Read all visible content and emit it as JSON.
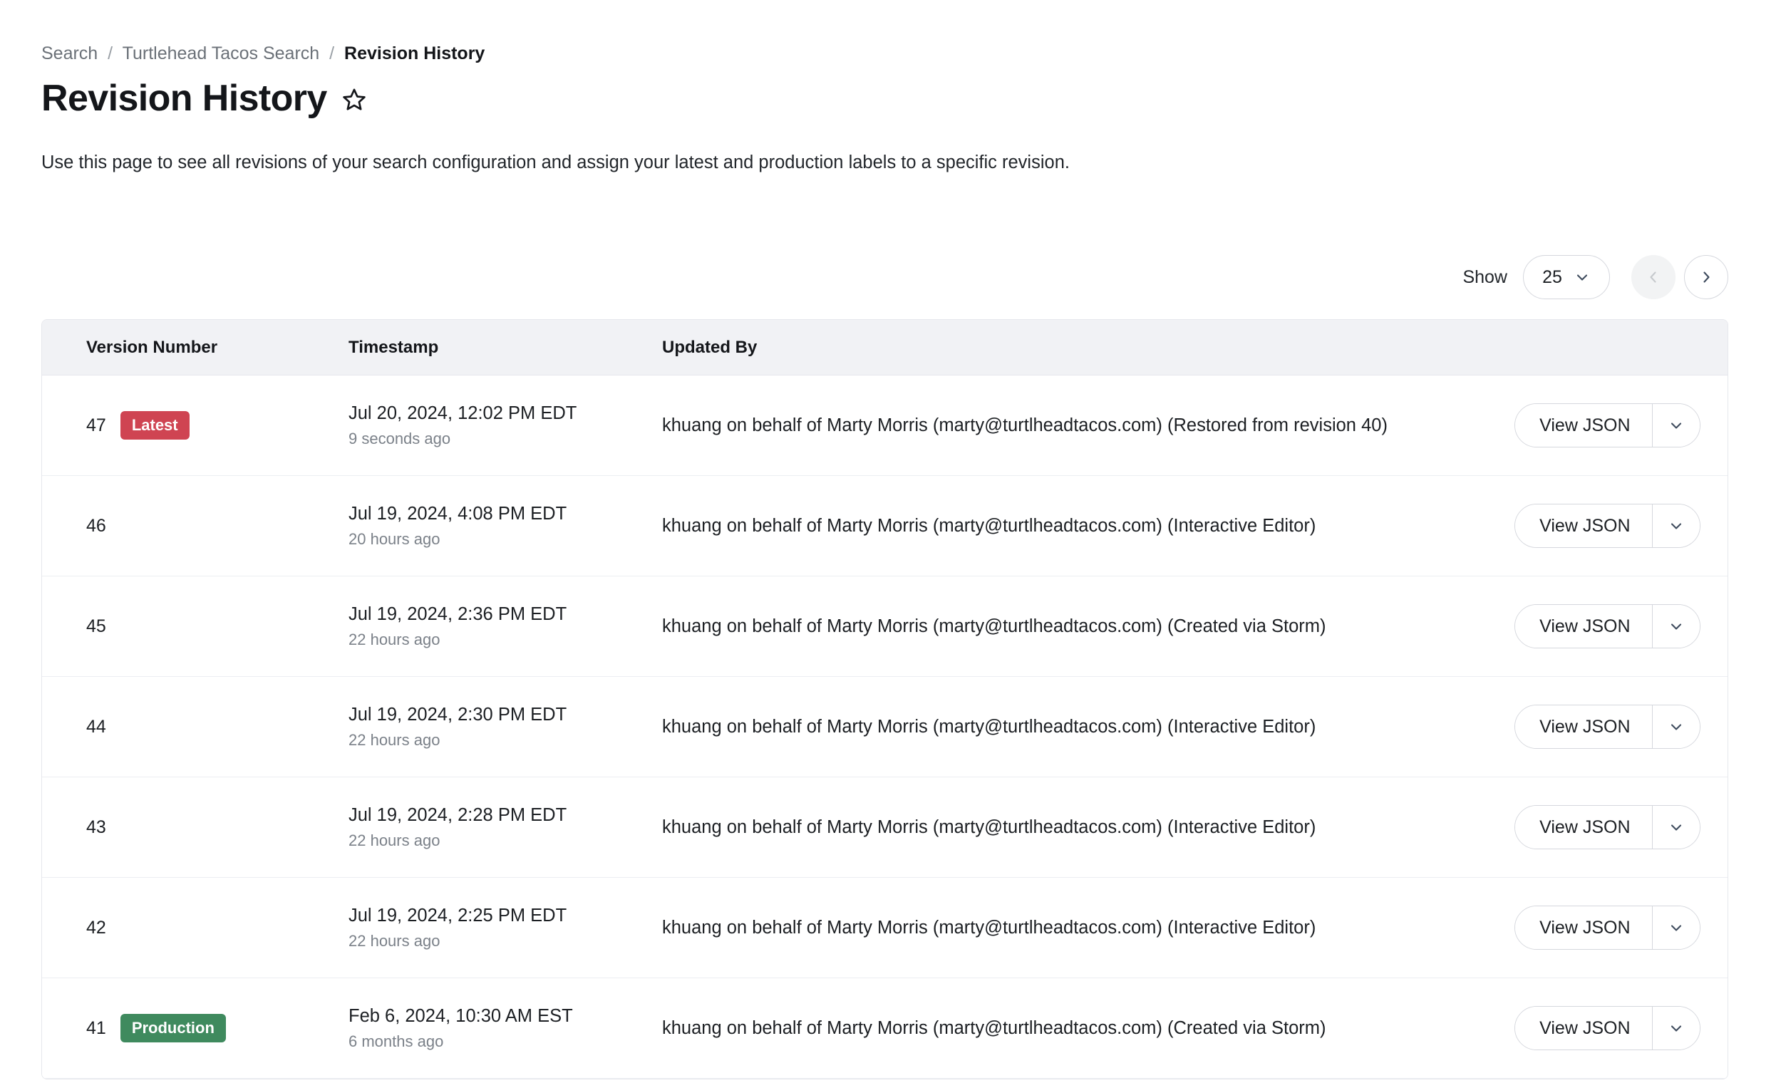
{
  "breadcrumb": {
    "items": [
      {
        "label": "Search",
        "current": false
      },
      {
        "label": "Turtlehead Tacos Search",
        "current": false
      },
      {
        "label": "Revision History",
        "current": true
      }
    ],
    "separator": "/"
  },
  "header": {
    "title": "Revision History",
    "favorite_icon": "star-outline-icon",
    "description": "Use this page to see all revisions of your search configuration and assign your latest and production labels to a specific revision."
  },
  "toolbar": {
    "show_label": "Show",
    "page_size_value": "25",
    "page_size_options": [
      "25"
    ],
    "prev_label": "Previous page",
    "next_label": "Next page",
    "prev_enabled": false,
    "next_enabled": true
  },
  "table": {
    "columns": [
      "Version Number",
      "Timestamp",
      "Updated By"
    ],
    "action_label": "View JSON",
    "rows": [
      {
        "version": "47",
        "badge": "Latest",
        "badge_type": "latest",
        "timestamp": "Jul 20, 2024, 12:02 PM EDT",
        "relative": "9 seconds ago",
        "updated_by": "khuang on behalf of Marty Morris (marty@turtlheadtacos.com) (Restored from revision 40)",
        "action": "View JSON"
      },
      {
        "version": "46",
        "badge": "",
        "badge_type": "",
        "timestamp": "Jul 19, 2024, 4:08 PM EDT",
        "relative": "20 hours ago",
        "updated_by": "khuang on behalf of Marty Morris (marty@turtlheadtacos.com) (Interactive Editor)",
        "action": "View JSON"
      },
      {
        "version": "45",
        "badge": "",
        "badge_type": "",
        "timestamp": "Jul 19, 2024, 2:36 PM EDT",
        "relative": "22 hours ago",
        "updated_by": "khuang on behalf of Marty Morris (marty@turtlheadtacos.com) (Created via Storm)",
        "action": "View JSON"
      },
      {
        "version": "44",
        "badge": "",
        "badge_type": "",
        "timestamp": "Jul 19, 2024, 2:30 PM EDT",
        "relative": "22 hours ago",
        "updated_by": "khuang on behalf of Marty Morris (marty@turtlheadtacos.com) (Interactive Editor)",
        "action": "View JSON"
      },
      {
        "version": "43",
        "badge": "",
        "badge_type": "",
        "timestamp": "Jul 19, 2024, 2:28 PM EDT",
        "relative": "22 hours ago",
        "updated_by": "khuang on behalf of Marty Morris (marty@turtlheadtacos.com) (Interactive Editor)",
        "action": "View JSON"
      },
      {
        "version": "42",
        "badge": "",
        "badge_type": "",
        "timestamp": "Jul 19, 2024, 2:25 PM EDT",
        "relative": "22 hours ago",
        "updated_by": "khuang on behalf of Marty Morris (marty@turtlheadtacos.com) (Interactive Editor)",
        "action": "View JSON"
      },
      {
        "version": "41",
        "badge": "Production",
        "badge_type": "production",
        "timestamp": "Feb 6, 2024, 10:30 AM EST",
        "relative": "6 months ago",
        "updated_by": "khuang on behalf of Marty Morris (marty@turtlheadtacos.com) (Created via Storm)",
        "action": "View JSON"
      }
    ]
  },
  "colors": {
    "latest_badge": "#cf4452",
    "production_badge": "#3f8a5e",
    "header_bg": "#f1f2f5",
    "border": "#e6e7ec",
    "text_primary": "#1c1f23",
    "text_muted": "#7b8189",
    "chevron": "#3d4a5c"
  }
}
